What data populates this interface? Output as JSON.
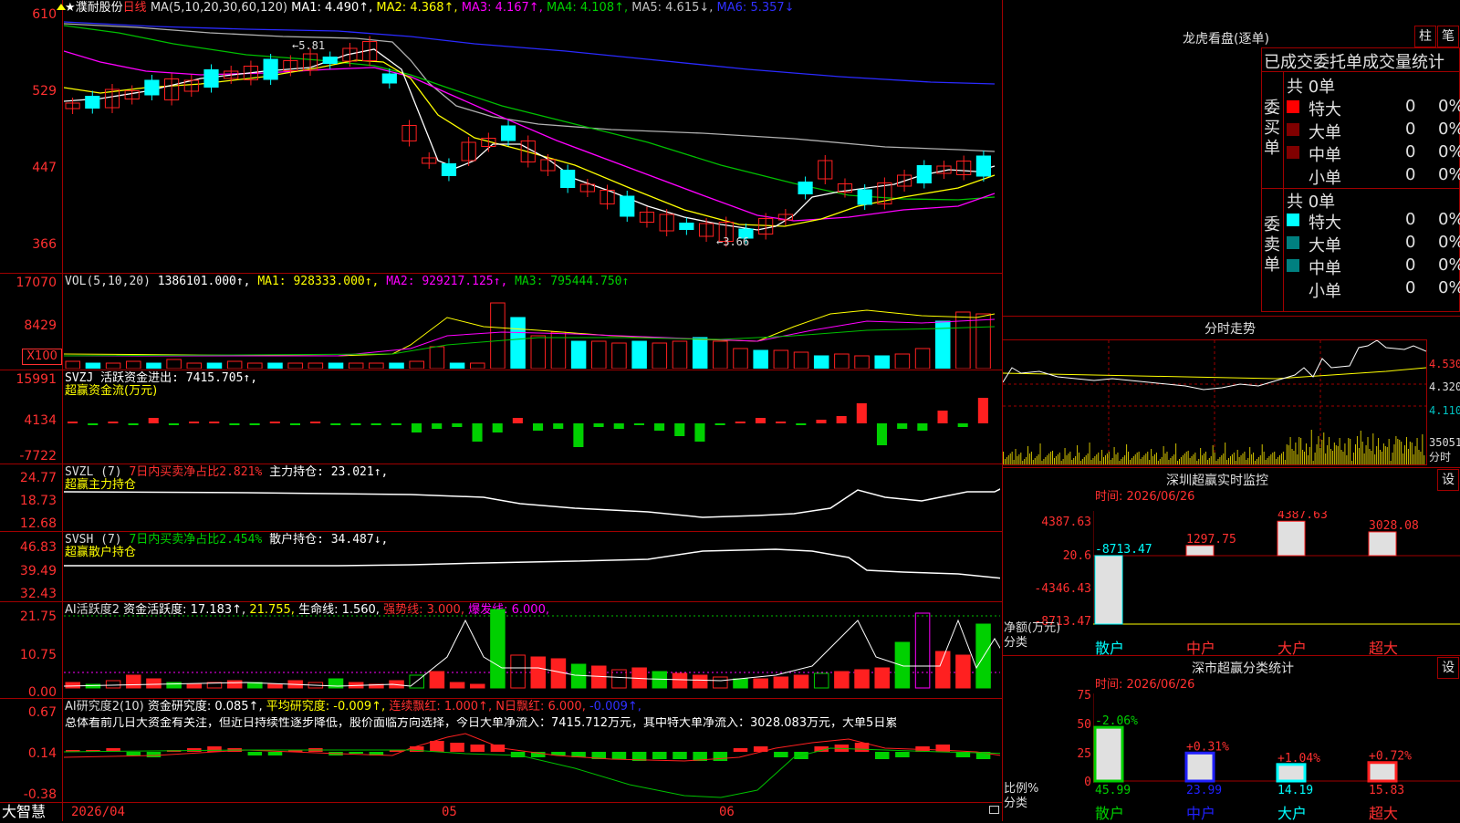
{
  "window": {
    "app_logo": "大智慧",
    "date_start": "2026/04",
    "month_05": "05",
    "month_06": "06"
  },
  "colors": {
    "up": "#ff2020",
    "down": "#00ffff",
    "ma1": "#ffffff",
    "ma2": "#ffff00",
    "ma3": "#ff00ff",
    "ma4": "#00c000",
    "ma5": "#c0c0c0",
    "ma6": "#2020ff",
    "frame": "#a00000"
  },
  "main": {
    "star": "★",
    "stock_name": "濮耐股份",
    "period": "日线",
    "ma_params": "MA(5,10,20,30,60,120)",
    "ma1": "MA1: 4.490↑,",
    "ma2": "MA2: 4.368↑,",
    "ma3": "MA3: 4.167↑,",
    "ma4": "MA4: 4.108↑,",
    "ma5": "MA5: 4.615↓,",
    "ma6": "MA6: 5.357↓",
    "y_labels": [
      "610",
      "529",
      "447",
      "366"
    ],
    "high_mark": "←5.81",
    "low_mark": "←3.66"
  },
  "vol": {
    "title": "VOL(5,10,20)",
    "value": "1386101.000↑,",
    "ma1": "MA1: 928333.000↑,",
    "ma2": "MA2: 929217.125↑,",
    "ma3": "MA3: 795444.750↑",
    "y_labels": [
      "17070",
      "8429"
    ],
    "unit": "X100"
  },
  "svzj": {
    "title": "SVZJ  活跃资金进出: 7415.705↑,",
    "subtitle": "超赢资金流(万元)",
    "y_labels": [
      "15991",
      "4134",
      "-7722"
    ]
  },
  "svzl": {
    "title": "SVZL (7)",
    "desc": "7日内买卖净占比2.821%",
    "hold": "主力持仓: 23.021↑,",
    "subtitle": "超赢主力持仓",
    "y_labels": [
      "24.77",
      "18.73",
      "12.68"
    ]
  },
  "svsh": {
    "title": "SVSH (7)",
    "desc": "7日内买卖净占比2.454%",
    "hold": "散户持仓: 34.487↓,",
    "subtitle": "超赢散户持仓",
    "y_labels": [
      "46.83",
      "39.49",
      "32.43"
    ]
  },
  "ai_active": {
    "title": "AI活跃度2",
    "t1": "资金活跃度: 17.183↑,",
    "t2": "21.755,",
    "t3": "生命线: 1.560,",
    "t4": "强势线: 3.000,",
    "t5": "爆发线: 6.000,",
    "y_labels": [
      "21.75",
      "10.75",
      "0.00"
    ]
  },
  "ai_research": {
    "title": "AI研究度2(10)",
    "t1": "资金研究度: 0.085↑,",
    "t2": "平均研究度: -0.009↑,",
    "t3": "连续飘红: 1.000↑,",
    "t4": "N日飘红: 6.000,",
    "t5": "-0.009↑,",
    "summary": "总体看前几日大资金有关注，但近日持续性逐步降低，股价面临方向选择，今日大单净流入：7415.712万元，其中特大单净流入：3028.083万元，大单5日累",
    "y_labels": [
      "0.67",
      "0.14",
      "-0.38"
    ]
  },
  "lhb": {
    "title": "龙虎看盘(逐单)",
    "btn1": "柱",
    "btn2": "笔",
    "header": "已成交委托单成交量统计",
    "buy_label": "委买单",
    "sell_label": "委卖单",
    "buy_total": "共 0单",
    "sell_total": "共 0单",
    "buy_rows": [
      {
        "name": "特大",
        "qty": "0",
        "pct": "0%"
      },
      {
        "name": "大单",
        "qty": "0",
        "pct": "0%"
      },
      {
        "name": "中单",
        "qty": "0",
        "pct": "0%"
      },
      {
        "name": "小单",
        "qty": "0",
        "pct": "0%"
      }
    ],
    "sell_rows": [
      {
        "name": "特大",
        "qty": "0",
        "pct": "0%"
      },
      {
        "name": "大单",
        "qty": "0",
        "pct": "0%"
      },
      {
        "name": "中单",
        "qty": "0",
        "pct": "0%"
      },
      {
        "name": "小单",
        "qty": "0",
        "pct": "0%"
      }
    ]
  },
  "fenshi": {
    "title": "分时走势",
    "y_labels": [
      "4.530",
      "4.320",
      "4.110",
      "35051",
      "分时"
    ]
  },
  "sz_monitor": {
    "title": "深圳超赢实时监控",
    "btn": "设",
    "time": "时间: 2026/06/26",
    "y_labels": [
      "4387.63",
      "20.6",
      "-4346.43",
      "-8713.47"
    ],
    "axis_label": "净额(万元)",
    "axis_label2": "分类",
    "categories": [
      "散户",
      "中户",
      "大户",
      "超大"
    ],
    "values": [
      -8713.47,
      1297.75,
      4387.63,
      3028.08
    ],
    "value_labels": [
      "-8713.47",
      "1297.75",
      "4387.63",
      "3028.08"
    ]
  },
  "sz_class": {
    "title": "深市超赢分类统计",
    "btn": "设",
    "time": "时间: 2026/06/26",
    "y_labels": [
      "75",
      "50",
      "25",
      "0"
    ],
    "axis_label": "比例%",
    "axis_label2": "分类",
    "categories": [
      "散户",
      "中户",
      "大户",
      "超大"
    ],
    "values": [
      45.99,
      23.99,
      14.19,
      15.83
    ],
    "value_labels": [
      "45.99",
      "23.99",
      "14.19",
      "15.83"
    ],
    "changes": [
      "-2.06%",
      "+0.31%",
      "+1.04%",
      "+0.72%"
    ]
  }
}
